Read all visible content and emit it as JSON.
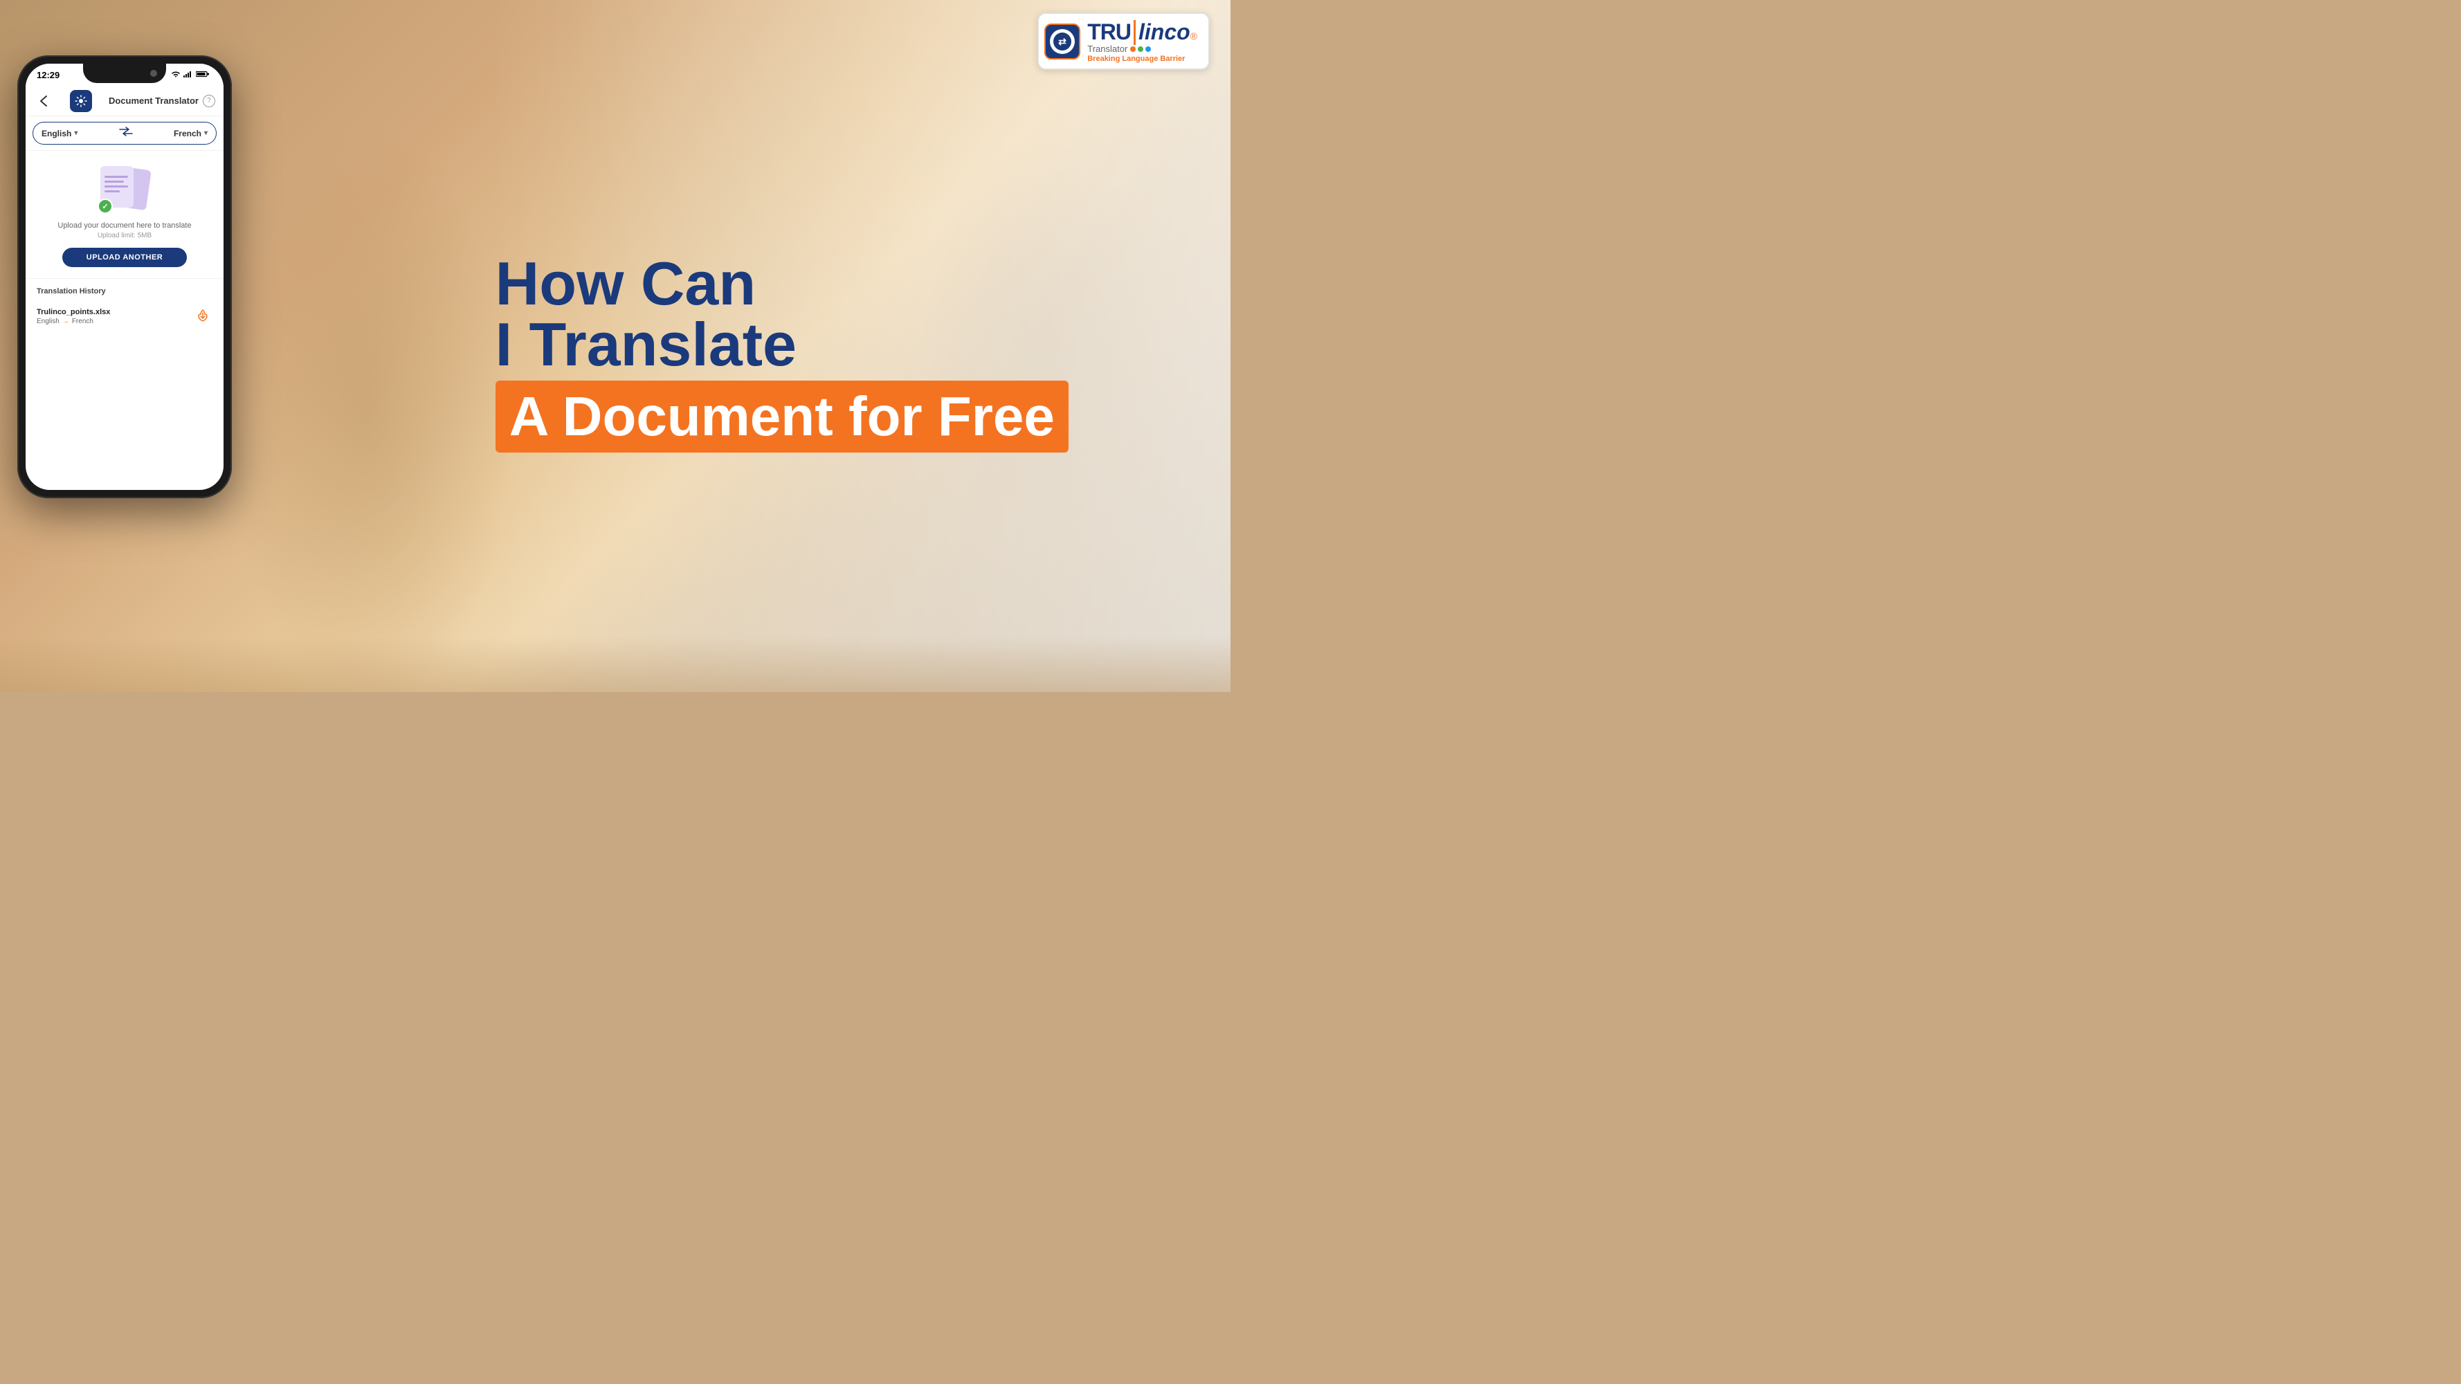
{
  "page": {
    "background_color": "#c8a882"
  },
  "logo": {
    "tru_text": "TRU",
    "linco_text": "linco",
    "registered_symbol": "®",
    "translator_text": "Translator",
    "subtitle": "Breaking Language Barrier",
    "icon_symbol": "⇄"
  },
  "phone": {
    "status_bar": {
      "time": "12:29",
      "wifi_icon": "wifi",
      "signal_icon": "signal",
      "battery_icon": "battery"
    },
    "header": {
      "back_icon": "‹",
      "title": "Document Translator",
      "help_icon": "?",
      "gear_icon": "⚙"
    },
    "language_bar": {
      "source_language": "English",
      "target_language": "French",
      "swap_icon": "⇄",
      "source_arrow": "▾",
      "target_arrow": "▾"
    },
    "upload_section": {
      "description": "Upload your document here to translate",
      "limit_text": "Upload limit: 5MB",
      "button_label": "UPLOAD ANOTHER",
      "check_icon": "✓",
      "doc_icon": "doc"
    },
    "translation_history": {
      "title": "Translation History",
      "items": [
        {
          "filename": "Trulinco_points.xlsx",
          "source_lang": "English",
          "target_lang": "French",
          "arrow": "→",
          "download_icon": "⬇"
        }
      ]
    }
  },
  "headline": {
    "line1": "How Can",
    "line2": "I Translate",
    "line3": "A Document for Free",
    "highlight_text": "A Document for Free"
  },
  "dots": [
    {
      "color": "#f47321"
    },
    {
      "color": "#4CAF50"
    },
    {
      "color": "#2196F3"
    }
  ]
}
